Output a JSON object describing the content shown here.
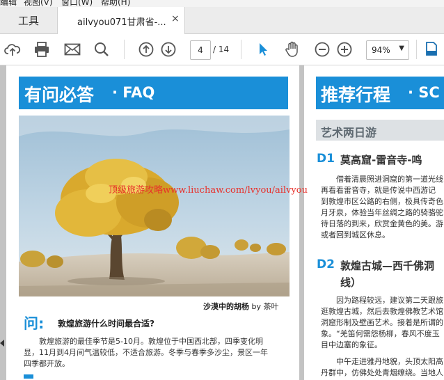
{
  "menubar": {
    "items": [
      "编辑",
      "视图(V)",
      "窗口(W)",
      "帮助(H)"
    ]
  },
  "tabs": {
    "tools_label": "工具",
    "doc_title": "ailvyou071甘肃省-...",
    "close_label": "×"
  },
  "toolbar": {
    "icons": [
      "upload-icon",
      "print-icon",
      "mail-icon",
      "search-icon",
      "page-up-icon",
      "page-down-icon",
      "select-arrow-icon",
      "hand-icon",
      "zoom-out-icon",
      "zoom-in-icon",
      "export-icon"
    ],
    "page_current": "4",
    "page_total": "/ 14",
    "zoom": "94%",
    "accent": "#1a8fd8"
  },
  "page_left": {
    "banner_big": "有问必答",
    "banner_small": "· FAQ",
    "caption_bold": "沙漠中的胡杨",
    "caption_by": "by 茶叶",
    "q_mark": "问:",
    "question": "敦煌旅游什么时间最合适?",
    "answer_lines": [
      "敦煌旅游的最佳季节是5-10月。敦煌位于中国西北部，四季变化明",
      "显，11月到4月间气温较低，不适合旅游。冬季与春季多沙尘，景区一年",
      "四季都开放。"
    ]
  },
  "page_right": {
    "banner_big": "推荐行程",
    "banner_small": "· SC",
    "sub_heading": "艺术两日游",
    "d1_label": "D1",
    "d1_title": "莫高窟-雷音寺-鸣",
    "d1_lines": [
      "借着清晨照进洞窟的第一道光线",
      "再看看雷音寺，就是传说中西游记",
      "到敦煌市区公路的右侧，极具传奇色",
      "月牙泉，体验当年丝绸之路的骑骆驼",
      "待日落的到来，欣赏金黄色的美。游",
      "或者回到城区休息。"
    ],
    "d2_label": "D2",
    "d2_title_1": "敦煌古城—西千佛洞",
    "d2_title_2": "线）",
    "d2_lines": [
      "因为路程较远，建议第二天跟旅",
      "逛敦煌古城，然后去敦煌佛教艺术馆",
      "洞窟形制及壁画艺术。接着是所谓的",
      "象。“羌笛何需怨杨柳，春风不度玉",
      "目中边塞的象征。",
      "",
      "中午走进雅丹地貌，头顶太阳高",
      "丹群中，仿佛处处青烟缭绕。当地人"
    ]
  },
  "watermark": "顶级旅游攻略www.liuchaw.com/lvyou/ailvyou"
}
